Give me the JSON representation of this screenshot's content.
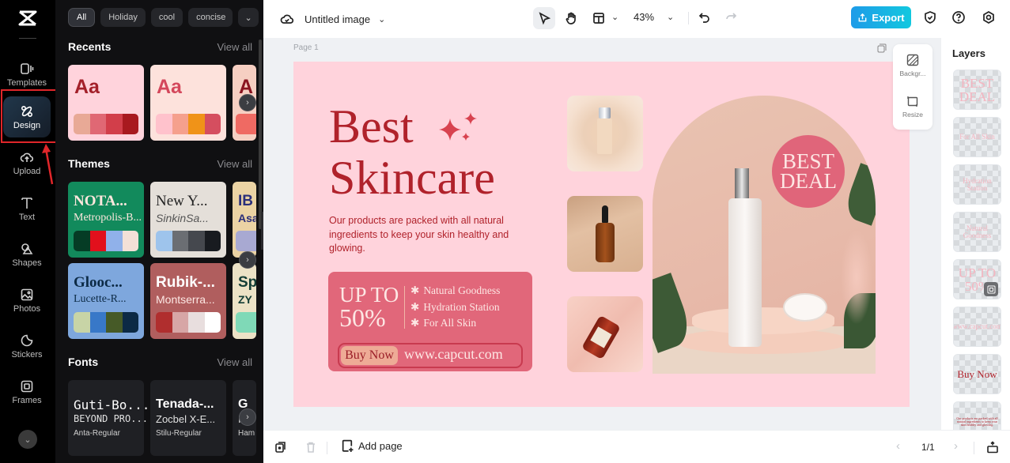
{
  "rail": {
    "items": [
      {
        "label": "Templates",
        "icon": "templates-icon"
      },
      {
        "label": "Design",
        "icon": "design-icon",
        "active": true
      },
      {
        "label": "Upload",
        "icon": "upload-cloud-icon"
      },
      {
        "label": "Text",
        "icon": "text-icon"
      },
      {
        "label": "Shapes",
        "icon": "shapes-icon"
      },
      {
        "label": "Photos",
        "icon": "photos-icon"
      },
      {
        "label": "Stickers",
        "icon": "stickers-icon"
      },
      {
        "label": "Frames",
        "icon": "frames-icon"
      }
    ],
    "more_icon": "chevron-down-icon"
  },
  "panel": {
    "chips": [
      "All",
      "Holiday",
      "cool",
      "concise"
    ],
    "chip_more_icon": "chevron-down-icon",
    "sections": {
      "recents": {
        "title": "Recents",
        "view_all": "View all"
      },
      "themes": {
        "title": "Themes",
        "view_all": "View all"
      },
      "fonts": {
        "title": "Fonts",
        "view_all": "View all"
      }
    },
    "recents": [
      {
        "text": "Aa",
        "text_color": "#a3202a",
        "bg": "#ffd3dc",
        "swatches": [
          "#e8a996",
          "#e06874",
          "#d23e4a",
          "#a8191f"
        ]
      },
      {
        "text": "Aa",
        "text_color": "#d4475b",
        "bg": "#fde2dc",
        "swatches": [
          "#ffc2cc",
          "#f5a08d",
          "#f09318",
          "#d54e5f"
        ]
      },
      {
        "text": "A",
        "text_color": "#8a1420",
        "bg": "#f6cfc2",
        "swatches": [
          "#ef6a63"
        ]
      }
    ],
    "themes": [
      {
        "title": "NOTA...",
        "subtitle": "Metropolis-B...",
        "bg": "#128a5c",
        "title_color": "#fde7dd",
        "subtitle_color": "#fde7dd",
        "swatches": [
          "#053c25",
          "#e2101c",
          "#90b1ea",
          "#f3e0d7"
        ]
      },
      {
        "title": "New Y...",
        "subtitle": "SinkinSa...",
        "bg": "#e4dfd9",
        "title_color": "#222",
        "subtitle_color": "#555",
        "swatches": [
          "#9ec4ec",
          "#6b6e73",
          "#45484e",
          "#181b20"
        ]
      },
      {
        "title": "IB",
        "subtitle": "Asa",
        "bg": "#ebd3a4",
        "title_color": "#2b2f7a",
        "subtitle_color": "#2b2f7a",
        "swatches": [
          "#a8a9d2"
        ]
      },
      {
        "title": "Glooc...",
        "subtitle": "Lucette-R...",
        "bg": "#7ea7dd",
        "title_color": "#0c2a45",
        "subtitle_color": "#0c2a45",
        "swatches": [
          "#c8d4a6",
          "#3878c8",
          "#465a27",
          "#0c2a45"
        ]
      },
      {
        "title": "Rubik-...",
        "subtitle": "Montserra...",
        "bg": "#b05e5e",
        "title_color": "#fff",
        "subtitle_color": "#fde8e4",
        "swatches": [
          "#b02e2e",
          "#d7a6a6",
          "#e8dede",
          "#ffffff"
        ]
      },
      {
        "title": "Sp",
        "subtitle": "ZY",
        "bg": "#ece2c6",
        "title_color": "#123c35",
        "subtitle_color": "#123c35",
        "swatches": [
          "#7fd9b7"
        ]
      }
    ],
    "fonts": [
      {
        "title": "Guti-Bo...",
        "subtitle": "BEYOND PRO...",
        "caption": "Anta-Regular"
      },
      {
        "title": "Tenada-...",
        "subtitle": "Zocbel X-E...",
        "caption": "Stilu-Regular"
      },
      {
        "title": "G",
        "subtitle": "I",
        "caption": "Ham"
      }
    ],
    "next_icon": "chevron-right-icon"
  },
  "topbar": {
    "cloud_icon": "cloud-saved-icon",
    "title": "Untitled image",
    "zoom": "43%",
    "export_label": "Export",
    "icons": [
      "select-pointer-icon",
      "hand-pan-icon",
      "layout-icon",
      "undo-icon",
      "redo-icon",
      "shield-icon",
      "help-icon",
      "settings-icon"
    ]
  },
  "canvas": {
    "page_label": "Page 1",
    "design": {
      "headline_1": "Best",
      "headline_2": "Skincare",
      "description": "Our products are packed with all natural ingredients to keep your skin healthy and glowing.",
      "promo_line_1": "UP TO",
      "promo_line_2": "50%",
      "features": [
        "Natural Goodness",
        "Hydration Station",
        "For All Skin"
      ],
      "feature_bullet": "✱",
      "buy_label": "Buy Now",
      "url": "www.capcut.com",
      "badge_line_1": "BEST",
      "badge_line_2": "DEAL",
      "colors": {
        "background": "#ffd3dc",
        "primary": "#b0222b",
        "promo": "#e1677a",
        "cream": "#fde7e4"
      }
    },
    "float_panel": [
      {
        "label": "Backgr...",
        "icon": "background-icon"
      },
      {
        "label": "Resize",
        "icon": "resize-icon"
      }
    ]
  },
  "layers": {
    "title": "Layers",
    "items": [
      {
        "text": "BEST DEAL",
        "kind": "text"
      },
      {
        "text": "For All Skin",
        "kind": "text"
      },
      {
        "text": "Hydration Station",
        "kind": "text"
      },
      {
        "text": "Natural Goodness",
        "kind": "text"
      },
      {
        "text": "UP TO 50%",
        "kind": "text",
        "selected_badge": true
      },
      {
        "text": "www.capcut.com",
        "kind": "text"
      },
      {
        "text": "Buy Now",
        "kind": "text"
      },
      {
        "text": "Our products are packed with all natural ingredients to keep your skin healthy and glowing.",
        "kind": "text"
      }
    ]
  },
  "bottombar": {
    "add_page_label": "Add page",
    "page_indicator": "1/1"
  }
}
